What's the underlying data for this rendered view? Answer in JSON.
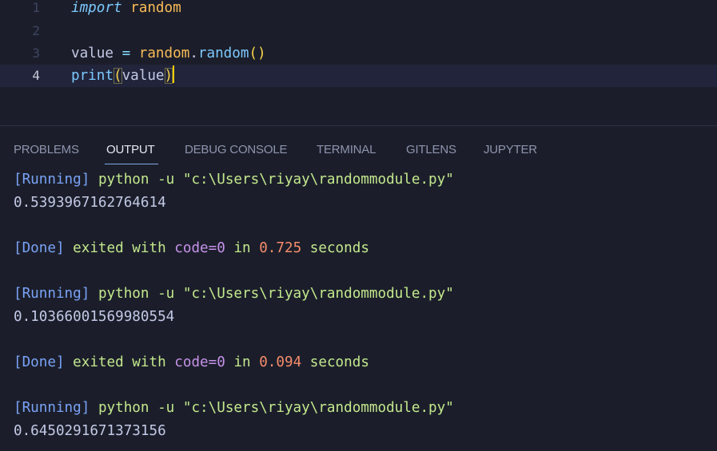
{
  "editor": {
    "lines": [
      {
        "num": "1",
        "kw": "import",
        "module": "random"
      },
      {
        "num": "2"
      },
      {
        "num": "3",
        "var": "value",
        "op": "=",
        "module": "random",
        "dot": ".",
        "func": "random",
        "parens": "()"
      },
      {
        "num": "4",
        "func": "print",
        "open": "(",
        "arg": "value",
        "close": ")"
      }
    ]
  },
  "panel": {
    "tabs": [
      "PROBLEMS",
      "OUTPUT",
      "DEBUG CONSOLE",
      "TERMINAL",
      "GITLENS",
      "JUPYTER"
    ],
    "active_tab": "OUTPUT"
  },
  "output": {
    "runs": [
      {
        "running_tag": "[Running]",
        "command": "python -u \"c:\\Users\\riyay\\randommodule.py\"",
        "result": "0.5393967162764614",
        "done_tag": "[Done]",
        "exited_text": "exited with",
        "code_text": "code=0",
        "in_text": "in",
        "seconds_value": "0.725",
        "seconds_text": "seconds"
      },
      {
        "running_tag": "[Running]",
        "command": "python -u \"c:\\Users\\riyay\\randommodule.py\"",
        "result": "0.10366001569980554",
        "done_tag": "[Done]",
        "exited_text": "exited with",
        "code_text": "code=0",
        "in_text": "in",
        "seconds_value": "0.094",
        "seconds_text": "seconds"
      },
      {
        "running_tag": "[Running]",
        "command": "python -u \"c:\\Users\\riyay\\randommodule.py\"",
        "result": "0.6450291671373156"
      }
    ]
  },
  "colors": {
    "background": "#1b1e2a",
    "keyword": "#7dc9ff",
    "module": "#f9bb57",
    "tag": "#7aa2f7",
    "green": "#c3e88d",
    "purple": "#c792ea",
    "orange": "#f78c6c"
  }
}
